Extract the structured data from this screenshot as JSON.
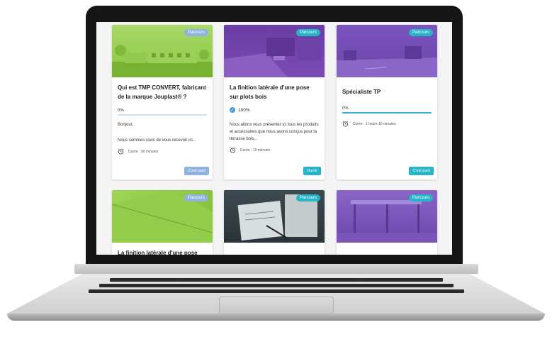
{
  "cards": [
    {
      "badge": "Parcours",
      "title": "Qui est TMP CONVERT, fabricant de la marque Jouplast® ?",
      "progress_label": "0%",
      "progress": 0,
      "desc1": "Bonjour,",
      "desc2": "Nous sommes ravis de vous recevoir ici...",
      "duration": "Durée : 30 minutes",
      "button": "C'est parti",
      "accent": "#8ac73f"
    },
    {
      "badge": "Parcours",
      "title": "La finition latérale d'une pose sur plots bois",
      "progress_label": "100%",
      "progress": 100,
      "desc1": "Nous allons vous présenter ici tous les produits et accessoires que nous avons conçus pour la terrasse bois...",
      "duration": "Durée : 10 minutes",
      "button": "Ouvrir",
      "accent": "#7b4bb4"
    },
    {
      "badge": "Parcours",
      "title": "Spécialiste TP",
      "progress_label": "0%",
      "progress": 0,
      "duration": "Durée : 1 heure 10 minutes",
      "button": "C'est parti",
      "accent": "#7b4bb4"
    },
    {
      "badge": "Parcours",
      "title": "La finition latérale d'une pose sur",
      "accent": "#8ac73f"
    },
    {
      "badge": "Parcours",
      "accent": "#2e3a40"
    },
    {
      "badge": "Parcours",
      "accent": "#7b4bb4"
    }
  ],
  "colors": {
    "badge_blue": "#8fb3e0",
    "badge_teal": "#26b5c6",
    "button_light": "#8fb3e0",
    "button_teal": "#26b5c6"
  }
}
